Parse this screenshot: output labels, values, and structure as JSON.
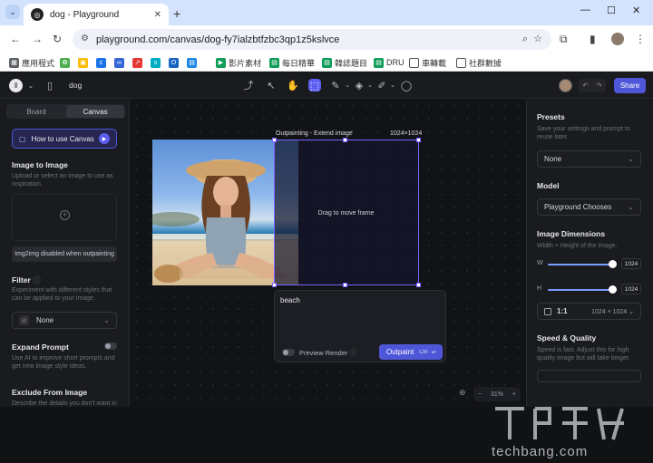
{
  "browser": {
    "tab_title": "dog - Playground",
    "url": "playground.com/canvas/dog-fy7ialzbtfzbc3qp1z5kslvce",
    "bookmarks": [
      "應用程式",
      "影片素材",
      "每日精華",
      "韓誌題目",
      "DRU",
      "車轉載",
      "社群數據"
    ]
  },
  "app": {
    "doc_name": "dog",
    "share_label": "Share",
    "left": {
      "tab_board": "Board",
      "tab_canvas": "Canvas",
      "how_to": "How to use Canvas",
      "img2img_title": "Image to Image",
      "img2img_desc": "Upload or select an image to use as inspiration.",
      "img2img_disabled": "Img2img disabled when outpainting",
      "filter_title": "Filter",
      "filter_desc": "Experiment with different styles that can be applied to your image.",
      "filter_value": "None",
      "expand_title": "Expand Prompt",
      "expand_desc": "Use AI to improve short prompts and get new image style ideas.",
      "exclude_title": "Exclude From Image",
      "exclude_desc": "Describe the details you don't want in"
    },
    "canvas": {
      "frame_label": "Outpainting - Extend image",
      "frame_size": "1024×1024",
      "frame_hint": "Drag to move frame",
      "prompt_text": "beach",
      "preview_label": "Preview Render",
      "outpaint_label": "Outpaint",
      "outpaint_shortcut": "Ctrl",
      "zoom_value": "31%"
    },
    "right": {
      "presets_title": "Presets",
      "presets_desc": "Save your settings and prompt to reuse later.",
      "presets_value": "None",
      "model_title": "Model",
      "model_value": "Playground Chooses",
      "dims_title": "Image Dimensions",
      "dims_desc": "Width × Height of the image.",
      "w_label": "W",
      "w_value": "1024",
      "h_label": "H",
      "h_value": "1024",
      "ratio_label": "1:1",
      "ratio_dims": "1024 × 1024",
      "speed_title": "Speed & Quality",
      "speed_desc": "Speed is fast. Adjust this for high quality image but will take longer."
    },
    "watermark": "techbang.com"
  }
}
